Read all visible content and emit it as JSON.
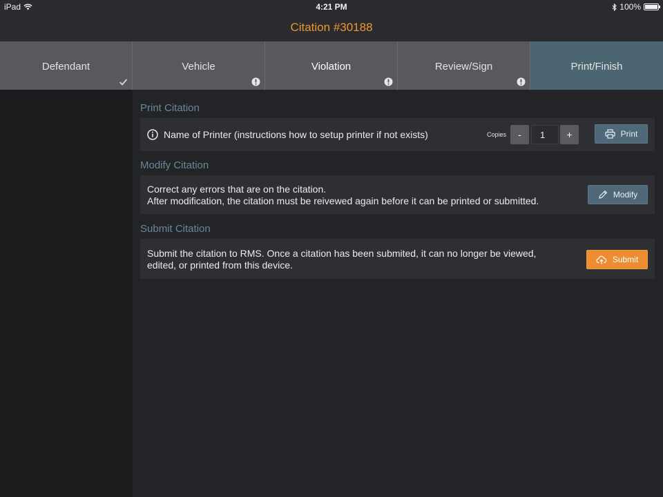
{
  "status_bar": {
    "device": "iPad",
    "time": "4:21 PM",
    "battery": "100%"
  },
  "header": {
    "title": "Citation #30188"
  },
  "tabs": [
    {
      "label": "Defendant",
      "status": "complete"
    },
    {
      "label": "Vehicle",
      "status": "warning"
    },
    {
      "label": "Violation",
      "status": "warning"
    },
    {
      "label": "Review/Sign",
      "status": "warning"
    },
    {
      "label": "Print/Finish",
      "status": "active"
    }
  ],
  "print_section": {
    "title": "Print Citation",
    "printer_name": "Name of Printer (instructions how to setup printer if not exists)",
    "copies_label": "Copies",
    "copies_value": "1",
    "decrement_label": "-",
    "increment_label": "+",
    "print_label": "Print"
  },
  "modify_section": {
    "title": "Modify Citation",
    "line1": "Correct any errors that are on the citation.",
    "line2": "After modification, the citation must be reivewed again before it can be printed or submitted.",
    "button_label": "Modify"
  },
  "submit_section": {
    "title": "Submit Citation",
    "line1": "Submit the citation to RMS. Once a citation has been submited, it can no longer be viewed,",
    "line2": "edited, or printed from this device.",
    "button_label": "Submit"
  },
  "colors": {
    "accent_orange": "#f0962f",
    "active_tab": "#4b6672",
    "section_title": "#6c8796"
  }
}
